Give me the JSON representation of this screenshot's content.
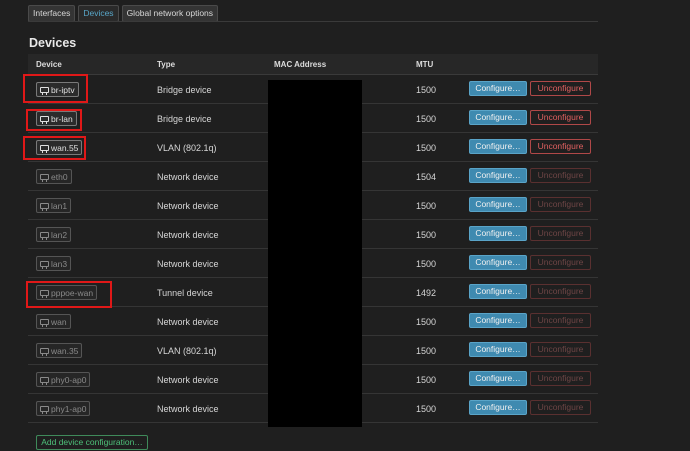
{
  "tabs": [
    {
      "label": "Interfaces"
    },
    {
      "label": "Devices"
    },
    {
      "label": "Global network options"
    }
  ],
  "section_title": "Devices",
  "columns": {
    "device": "Device",
    "type": "Type",
    "mac": "MAC Address",
    "mtu": "MTU"
  },
  "configure_label": "Configure…",
  "unconfigure_label": "Unconfigure",
  "add_label": "Add device configuration…",
  "rows": [
    {
      "device": "br-iptv",
      "type": "Bridge device",
      "mtu": "1500"
    },
    {
      "device": "br-lan",
      "type": "Bridge device",
      "mtu": "1500"
    },
    {
      "device": "wan.55",
      "type": "VLAN (802.1q)",
      "mtu": "1500"
    },
    {
      "device": "eth0",
      "type": "Network device",
      "mtu": "1504"
    },
    {
      "device": "lan1",
      "type": "Network device",
      "mtu": "1500"
    },
    {
      "device": "lan2",
      "type": "Network device",
      "mtu": "1500"
    },
    {
      "device": "lan3",
      "type": "Network device",
      "mtu": "1500"
    },
    {
      "device": "pppoe-wan",
      "type": "Tunnel device",
      "mtu": "1492"
    },
    {
      "device": "wan",
      "type": "Network device",
      "mtu": "1500"
    },
    {
      "device": "wan.35",
      "type": "VLAN (802.1q)",
      "mtu": "1500"
    },
    {
      "device": "phy0-ap0",
      "type": "Network device",
      "mtu": "1500"
    },
    {
      "device": "phy1-ap0",
      "type": "Network device",
      "mtu": "1500"
    }
  ],
  "colors": {
    "accent": "#3f8ab0",
    "danger": "#e06060",
    "add": "#4ec07a",
    "highlight": "#e01818"
  },
  "icons": {
    "device": "network-device-icon"
  }
}
